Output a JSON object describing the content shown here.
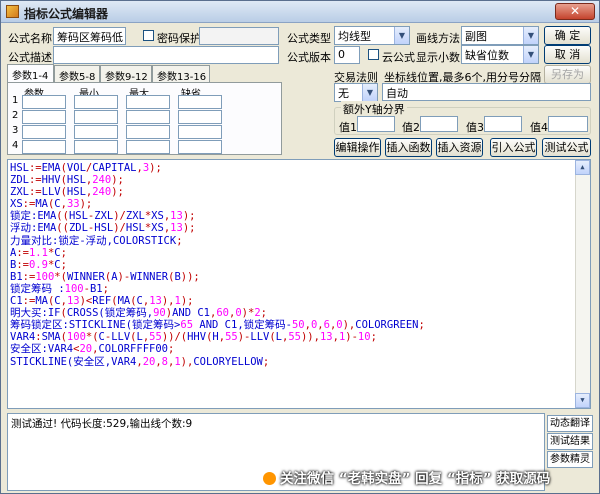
{
  "window": {
    "title": "指标公式编辑器",
    "close_symbol": "✕"
  },
  "form": {
    "name_label": "公式名称",
    "name_value": "筹码区筹码低",
    "password_label": "密码保护",
    "type_label": "公式类型",
    "type_value": "均线型",
    "draw_label": "画线方法",
    "draw_value": "副图",
    "desc_label": "公式描述",
    "desc_value": "",
    "version_label": "公式版本",
    "version_value": "0",
    "cloud_label": "云公式",
    "decimals_label": "显示小数",
    "decimals_value": "缺省位数"
  },
  "buttons": {
    "ok": "确 定",
    "cancel": "取 消",
    "save_as": "另存为",
    "edit_op": "编辑操作",
    "insert_func": "插入函数",
    "insert_res": "插入资源",
    "import": "引入公式",
    "test": "测试公式"
  },
  "tabs": [
    "参数1-4",
    "参数5-8",
    "参数9-12",
    "参数13-16"
  ],
  "param_table": {
    "headers": [
      "参数",
      "最小",
      "最大",
      "缺省"
    ],
    "rows": [
      "1",
      "2",
      "3",
      "4"
    ]
  },
  "trade_rule": {
    "label": "交易法则",
    "hint": "坐标线位置,最多6个,用分号分隔",
    "select_value": "无",
    "coord_value": "自动"
  },
  "extra_axis": {
    "title": "额外Y轴分界",
    "labels": [
      "值1",
      "值2",
      "值3",
      "值4"
    ]
  },
  "code": [
    "HSL:=EMA(VOL/CAPITAL,3);",
    "ZDL:=HHV(HSL,240);",
    "ZXL:=LLV(HSL,240);",
    "XS:=MA(C,33);",
    "锁定:EMA((HSL-ZXL)/ZXL*XS,13);",
    "浮动:EMA((ZDL-HSL)/HSL*XS,13);",
    "力量对比:锁定-浮动,COLORSTICK;",
    "A:=1.1*C;",
    "B:=0.9*C;",
    "B1:=100*(WINNER(A)-WINNER(B));",
    "锁定筹码 :100-B1;",
    "C1:=MA(C,13)<REF(MA(C,13),1);",
    "明大买:IF(CROSS(锁定筹码,90)AND C1,60,0)*2;",
    "筹码锁定区:STICKLINE(锁定筹码>65 AND C1,锁定筹码-50,0,6,0),COLORGREEN;",
    "VAR4:SMA(100*(C-LLV(L,55))/(HHV(H,55)-LLV(L,55)),13,1)-10;",
    "安全区:VAR4<20,COLORFFFF00;",
    "STICKLINE(安全区,VAR4,20,8,1),COLORYELLOW;"
  ],
  "status": {
    "message": "测试通过! 代码长度:529,输出线个数:9"
  },
  "side_buttons": [
    "动态翻译",
    "测试结果",
    "参数精灵"
  ],
  "watermark": {
    "text": "关注微信 “老韩实盘” 回复 “指标” 获取源码"
  },
  "colors": {
    "code_blue": "#0000d0",
    "code_red": "#c00000",
    "code_number": "#ff00ff"
  }
}
